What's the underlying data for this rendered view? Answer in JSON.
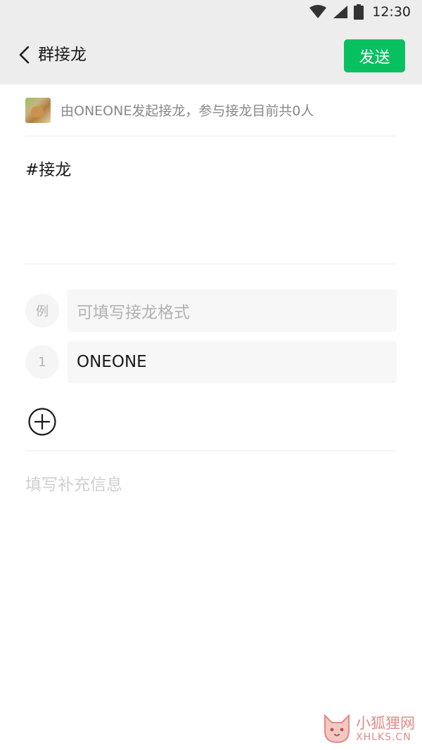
{
  "status_bar": {
    "time": "12:30",
    "icons": [
      "wifi-icon",
      "signal-icon",
      "battery-icon"
    ]
  },
  "header": {
    "back_icon": "chevron-left-icon",
    "title": "群接龙",
    "send_label": "发送"
  },
  "initiator": {
    "avatar": "avatar",
    "text": "由ONEONE发起接龙，参与接龙目前共0人"
  },
  "topic": {
    "text": "#接龙"
  },
  "entries": [
    {
      "index": "例",
      "placeholder": "可填写接龙格式",
      "value": ""
    },
    {
      "index": "1",
      "placeholder": "",
      "value": "ONEONE"
    }
  ],
  "add_icon": "plus-circle-icon",
  "extra_info": {
    "placeholder": "填写补充信息"
  },
  "watermark": {
    "text_cn": "小狐狸网",
    "text_en": "XHLKS.CN"
  },
  "colors": {
    "header_bg": "#ededed",
    "accent": "#07c160",
    "watermark": "#e28b86"
  }
}
